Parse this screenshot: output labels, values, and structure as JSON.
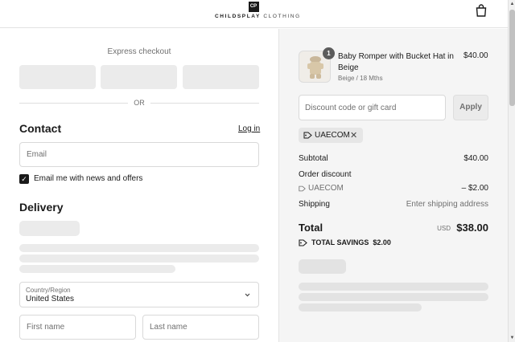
{
  "header": {
    "logo_mark": "CP",
    "brand_part1": "CHILDSPLAY",
    "brand_part2": "CLOTHING"
  },
  "express": {
    "title": "Express checkout",
    "or_label": "OR"
  },
  "contact": {
    "heading": "Contact",
    "login_link": "Log in",
    "email_placeholder": "Email",
    "newsletter_label": "Email me with news and offers",
    "newsletter_checked": true
  },
  "delivery": {
    "heading": "Delivery",
    "country_label": "Country/Region",
    "country_value": "United States",
    "first_name_placeholder": "First name",
    "last_name_placeholder": "Last name"
  },
  "cart": {
    "item": {
      "quantity": "1",
      "name": "Baby Romper with Bucket Hat in Beige",
      "variant": "Beige / 18 Mths",
      "price": "$40.00"
    },
    "discount_placeholder": "Discount code or gift card",
    "apply_label": "Apply",
    "applied_code": "UAECOM"
  },
  "summary": {
    "subtotal_label": "Subtotal",
    "subtotal_value": "$40.00",
    "order_discount_label": "Order discount",
    "discount_code": "UAECOM",
    "discount_value": "– $2.00",
    "shipping_label": "Shipping",
    "shipping_value": "Enter shipping address",
    "total_label": "Total",
    "total_currency": "USD",
    "total_value": "$38.00",
    "savings_label": "TOTAL SAVINGS",
    "savings_value": "$2.00"
  },
  "colors": {
    "text": "#1a1a1a",
    "muted": "#707070",
    "summary_bg": "#f5f5f5",
    "skeleton": "#ebebeb"
  },
  "icons": [
    "shopping-bag-icon",
    "tag-icon",
    "close-icon",
    "chevron-down-icon",
    "check-icon"
  ]
}
